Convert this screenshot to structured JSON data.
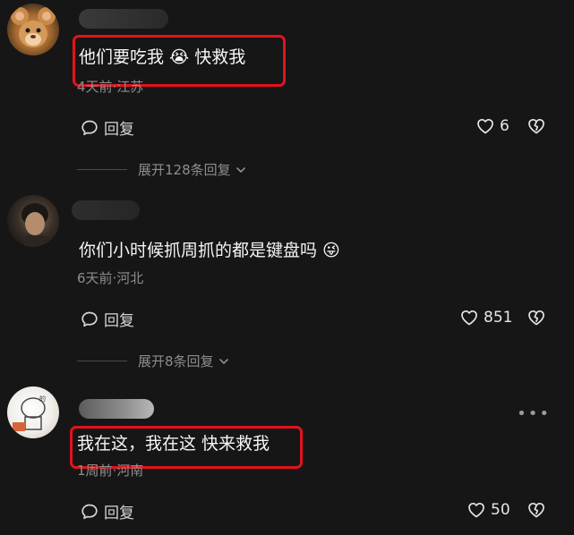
{
  "comments": [
    {
      "text": "他们要吃我 😭 快救我",
      "meta": "4天前·江苏",
      "reply_label": "回复",
      "likes": "6",
      "expand_label": "展开128条回复"
    },
    {
      "text": "你们小时候抓周抓的都是键盘吗 😜",
      "meta": "6天前·河北",
      "reply_label": "回复",
      "likes": "851",
      "expand_label": "展开8条回复"
    },
    {
      "text": "我在这，我在这 快来救我",
      "meta": "1周前·河南",
      "reply_label": "回复",
      "likes": "50"
    }
  ],
  "colors": {
    "background": "#161616",
    "highlight_border": "#e3131b",
    "meta_text": "#8d8d8d"
  },
  "icons": [
    "comment-bubble-icon",
    "heart-icon",
    "broken-heart-icon",
    "chevron-down-icon",
    "more-dots-icon"
  ]
}
